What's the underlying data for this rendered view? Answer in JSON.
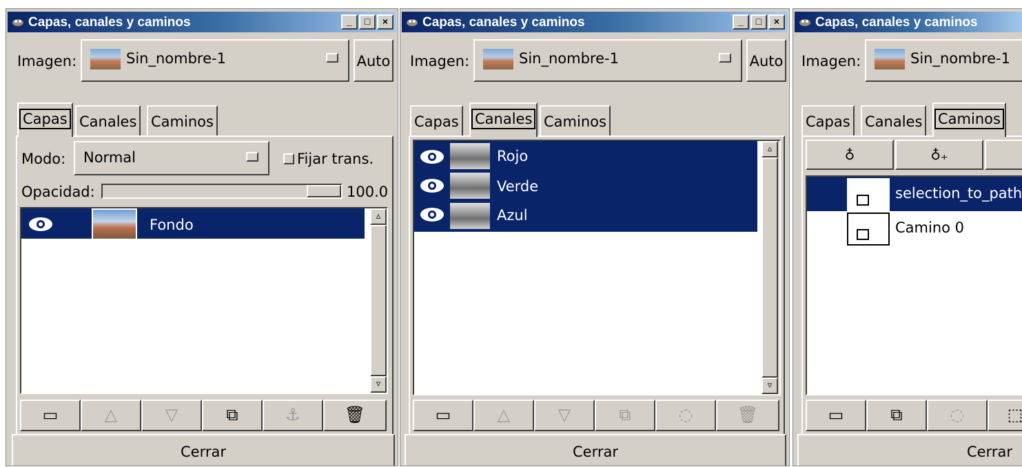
{
  "windows": [
    {
      "title": "Capas, canales y caminos",
      "image_label": "Imagen:",
      "image_value": "Sin_nombre-1",
      "auto_label": "Auto",
      "tabs": [
        "Capas",
        "Canales",
        "Caminos"
      ],
      "active_tab": "Capas",
      "mode_label": "Modo:",
      "mode_value": "Normal",
      "keep_trans_label": "Fijar trans.",
      "opacity_label": "Opacidad:",
      "opacity_value": "100.0",
      "layers": [
        {
          "name": "Fondo",
          "visible": true,
          "selected": true
        }
      ],
      "toolbar_icons": [
        "new-layer-icon",
        "raise-icon",
        "lower-icon",
        "duplicate-icon",
        "anchor-icon",
        "delete-icon"
      ],
      "close_label": "Cerrar"
    },
    {
      "title": "Capas, canales y caminos",
      "image_label": "Imagen:",
      "image_value": "Sin_nombre-1",
      "auto_label": "Auto",
      "tabs": [
        "Capas",
        "Canales",
        "Caminos"
      ],
      "active_tab": "Canales",
      "channels": [
        {
          "name": "Rojo",
          "visible": true,
          "selected": true
        },
        {
          "name": "Verde",
          "visible": true,
          "selected": true
        },
        {
          "name": "Azul",
          "visible": true,
          "selected": true
        }
      ],
      "toolbar_icons": [
        "new-channel-icon",
        "raise-icon",
        "lower-icon",
        "duplicate-icon",
        "channel-to-selection-icon",
        "delete-icon"
      ],
      "close_label": "Cerrar"
    },
    {
      "title": "Capas, canales y caminos",
      "image_label": "Imagen:",
      "image_value": "Sin_nombre-1",
      "tabs": [
        "Capas",
        "Canales",
        "Caminos"
      ],
      "active_tab": "Caminos",
      "tool_icons": [
        "new-point-icon",
        "add-point-icon",
        "delete-point-icon"
      ],
      "paths": [
        {
          "name": "selection_to_path",
          "selected": true
        },
        {
          "name": "Camino 0",
          "selected": false
        }
      ],
      "toolbar_icons": [
        "new-path-icon",
        "duplicate-icon",
        "path-to-selection-icon",
        "selection-to-path-icon"
      ],
      "close_label": "Cerrar"
    }
  ],
  "colors": {
    "selection": "#0a246a",
    "face": "#d4d0c8",
    "title_start": "#0a246a",
    "title_end": "#a6caf0"
  }
}
